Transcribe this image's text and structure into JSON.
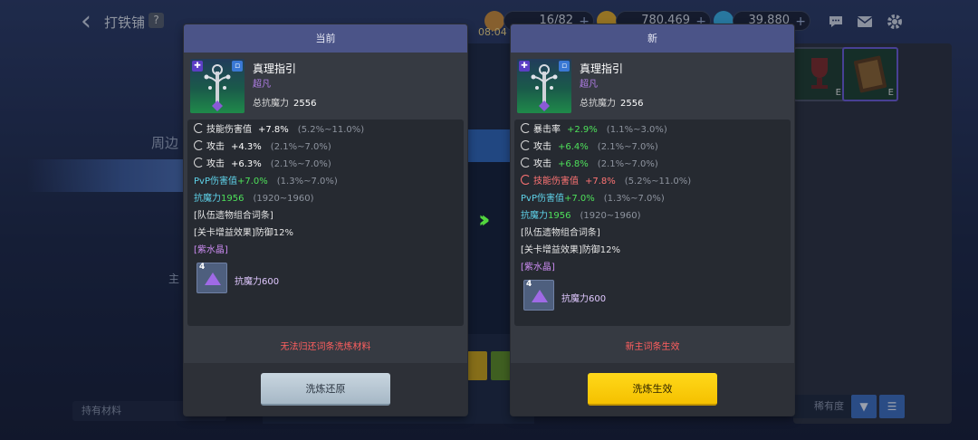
{
  "header": {
    "title": "打铁铺",
    "help": "?",
    "clock": "08:04",
    "resources": [
      {
        "name": "stamina",
        "value": "16/82"
      },
      {
        "name": "gold",
        "value": "780,469"
      },
      {
        "name": "gems",
        "value": "39,880"
      }
    ],
    "plus": "+"
  },
  "background": {
    "menu_items": [
      "周边",
      "主",
      "持有材料"
    ],
    "sort_label": "稀有度",
    "slot_letters": [
      "E",
      "E"
    ]
  },
  "current": {
    "header": "当前",
    "item_name": "真理指引",
    "item_grade": "超凡",
    "power_label": "总抗魔力",
    "power_value": "2556",
    "stats": [
      {
        "icon": true,
        "name": "技能伤害值",
        "value": "+7.8%",
        "range": "(5.2%~11.0%)",
        "value_color": "white"
      },
      {
        "icon": true,
        "name": "攻击",
        "value": "+4.3%",
        "range": "(2.1%~7.0%)",
        "value_color": "white"
      },
      {
        "icon": true,
        "name": "攻击",
        "value": "+6.3%",
        "range": "(2.1%~7.0%)",
        "value_color": "white"
      }
    ],
    "pvp": {
      "name": "PvP伤害值",
      "value": "+7.0%",
      "range": "(1.3%~7.0%)"
    },
    "magic_resist": {
      "name": "抗魔力",
      "value": "1956",
      "range": "(1920~1960)"
    },
    "set_label": "[队伍遗物组合词条]",
    "stage_label": "[关卡增益效果]防御12%",
    "crystal_label": "[紫水晶]",
    "gem": {
      "count": "4",
      "label": "抗魔力600"
    },
    "note": "无法归还词条洗炼材料",
    "button": "洗炼还原"
  },
  "new": {
    "header": "新",
    "item_name": "真理指引",
    "item_grade": "超凡",
    "power_label": "总抗魔力",
    "power_value": "2556",
    "stats": [
      {
        "icon": true,
        "name": "暴击率",
        "value": "+2.9%",
        "range": "(1.1%~3.0%)",
        "value_color": "green"
      },
      {
        "icon": true,
        "name": "攻击",
        "value": "+6.4%",
        "range": "(2.1%~7.0%)",
        "value_color": "green"
      },
      {
        "icon": true,
        "name": "攻击",
        "value": "+6.8%",
        "range": "(2.1%~7.0%)",
        "value_color": "green"
      },
      {
        "icon": true,
        "name": "技能伤害值",
        "value": "+7.8%",
        "range": "(5.2%~11.0%)",
        "value_color": "red"
      }
    ],
    "pvp": {
      "name": "PvP伤害值",
      "value": "+7.0%",
      "range": "(1.3%~7.0%)"
    },
    "magic_resist": {
      "name": "抗魔力",
      "value": "1956",
      "range": "(1920~1960)"
    },
    "set_label": "[队伍遗物组合词条]",
    "stage_label": "[关卡增益效果]防御12%",
    "crystal_label": "[紫水晶]",
    "gem": {
      "count": "4",
      "label": "抗魔力600"
    },
    "note": "新主词条生效",
    "button": "洗炼生效"
  },
  "colors": {
    "panel_header": "#4b5488",
    "apply_button": "#ffd81a",
    "restore_button": "#b8c8d4",
    "stat_up": "#4ee05a",
    "stat_removed": "#ff7474",
    "note_red": "#ff5f5f"
  }
}
